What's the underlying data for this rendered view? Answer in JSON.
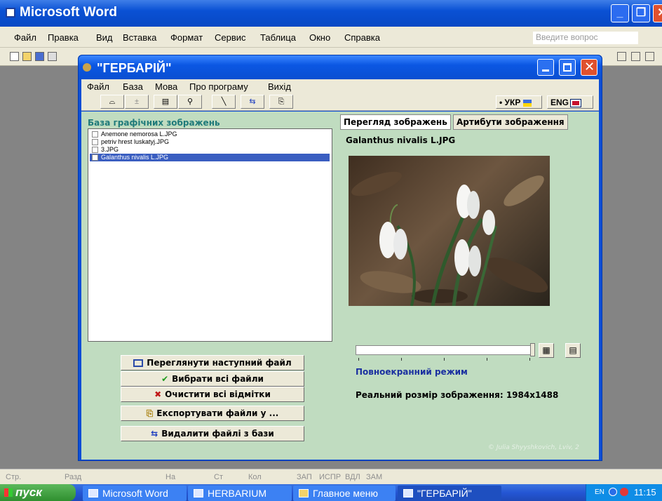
{
  "word": {
    "title": "Microsoft Word",
    "menu": [
      "Файл",
      "Правка",
      "Вид",
      "Вставка",
      "Формат",
      "Сервис",
      "Таблица",
      "Окно",
      "Справка"
    ],
    "ask_placeholder": "Введите вопрос",
    "status": [
      "Стр.",
      "Разд",
      "На",
      "Ст",
      "Кол",
      "ЗАП",
      "ИСПР",
      "ВДЛ",
      "ЗАМ"
    ]
  },
  "taskbar": {
    "start": "пуск",
    "tasks": [
      "Microsoft Word",
      "HERBARIUM",
      "Главное меню",
      "\"ГЕРБАРІЙ\""
    ],
    "tray_lang": "EN",
    "time": "11:15"
  },
  "app": {
    "title": "\"ГЕРБАРІЙ\"",
    "menu": [
      "Файл",
      "База",
      "Мова",
      "Про програму",
      "Вихід"
    ],
    "lang_ukr": "УКР",
    "lang_eng": "ENG",
    "db_title": "База графічних зображень",
    "files": [
      {
        "name": "Anemone nemorosa L.JPG",
        "selected": false
      },
      {
        "name": "petriv hrest luskatyj.JPG",
        "selected": false
      },
      {
        "name": "3.JPG",
        "selected": false
      },
      {
        "name": "Galanthus nivalis L.JPG",
        "selected": true
      }
    ],
    "buttons": {
      "next": "Переглянути наступний файл",
      "select_all": "Вибрати всі файли",
      "clear_all": "Очистити всі відмітки",
      "export": "Експортувати файли у ...",
      "delete": "Видалити файлі з бази"
    },
    "tabs": [
      "Перегляд зображень",
      "Артибути зображення"
    ],
    "image_name": "Galanthus nivalis L.JPG",
    "fullscreen": "Повноекранний режим",
    "real_size": "Реальний розмір зображення: 1984x1488",
    "zoom_fraction": 1.0,
    "copyright": "© Julia Shyyshkovich, Lviv, 2"
  }
}
